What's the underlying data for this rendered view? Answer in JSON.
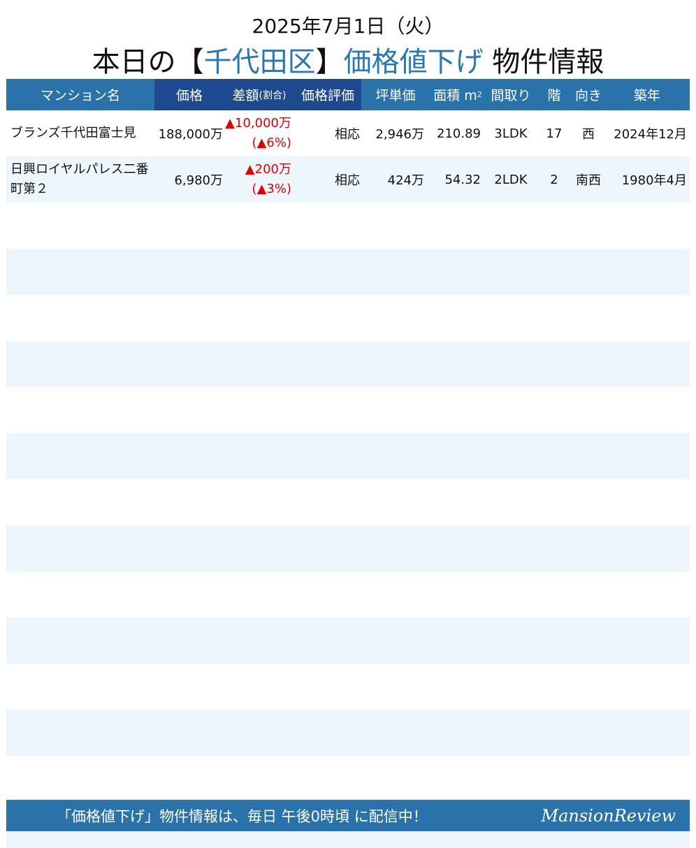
{
  "header": {
    "date": "2025年7月1日（火）",
    "title_prefix": "本日の【",
    "area": "千代田区",
    "title_bracket_close": "】",
    "title_keyword": "価格値下げ",
    "title_suffix": " 物件情報"
  },
  "table": {
    "columns": {
      "name": "マンション名",
      "price": "価格",
      "diff": "差額",
      "diff_sub": "(割合)",
      "rating": "価格評価",
      "tsubo": "坪単価",
      "area": "面積 m",
      "area_unit_sup": "2",
      "layout": "間取り",
      "floor": "階",
      "direction": "向き",
      "built": "築年"
    },
    "rows": [
      {
        "name": "ブランズ千代田富士見",
        "price": "188,000万",
        "diff": "▲10,000万",
        "ratio": "(▲6%)",
        "rating": "相応",
        "tsubo": "2,946万",
        "area": "210.89",
        "layout": "3LDK",
        "floor": "17",
        "direction": "西",
        "built": "2024年12月"
      },
      {
        "name": "日興ロイヤルパレス二番町第２",
        "price": "6,980万",
        "diff": "▲200万",
        "ratio": "(▲3%)",
        "rating": "相応",
        "tsubo": "424万",
        "area": "54.32",
        "layout": "2LDK",
        "floor": "2",
        "direction": "南西",
        "built": "1980年4月"
      }
    ],
    "empty_row_count": 14
  },
  "footer": {
    "message": "「価格値下げ」物件情報は、毎日 午後0時頃 に配信中！",
    "logo": "MansionReview"
  },
  "colors": {
    "header_blue": "#2a72aa",
    "header_dark_blue": "#1d4a8f",
    "highlight_blue": "#2878b8",
    "alt_row": "#eef6fd",
    "decrease_red": "#e00000"
  }
}
